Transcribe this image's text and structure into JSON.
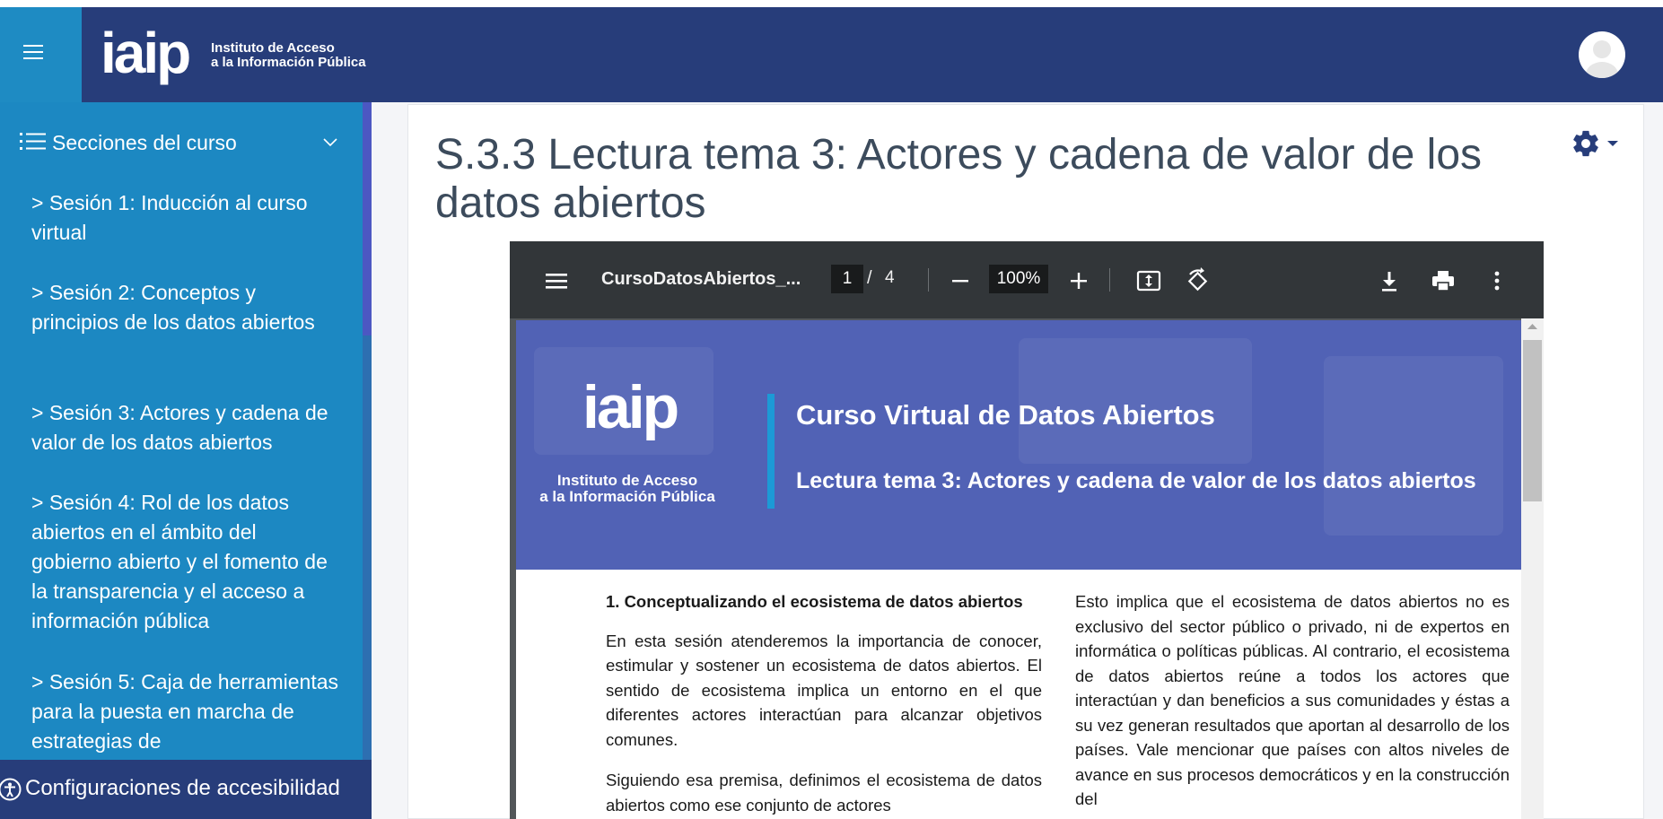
{
  "header": {
    "logo_word": "iaip",
    "logo_line1": "Instituto de Acceso",
    "logo_line2": "a la Información Pública"
  },
  "sidebar": {
    "sections_label": "Secciones del curso",
    "items": [
      {
        "label": "> Sesión 1: Inducción al curso virtual"
      },
      {
        "label": "> Sesión 2: Conceptos y principios de los datos abiertos"
      },
      {
        "label": "> Sesión 3: Actores y cadena de valor de los datos abiertos"
      },
      {
        "label": "> Sesión 4: Rol de los datos abiertos en el ámbito del gobierno abierto y el fomento de la transparencia y el acceso a información pública"
      },
      {
        "label": "> Sesión 5: Caja de herramientas para la puesta en marcha de estrategias de"
      }
    ],
    "accessibility_label": "Configuraciones de accesibilidad"
  },
  "main": {
    "title": "S.3.3 Lectura tema 3: Actores y cadena de valor de los datos abiertos"
  },
  "pdf": {
    "filename": "CursoDatosAbiertos_...",
    "current_page": "1",
    "separator": "/",
    "total_pages": "4",
    "zoom": "100%",
    "banner": {
      "logo_word": "iaip",
      "logo_line1": "Instituto de Acceso",
      "logo_line2": "a la Información Pública",
      "title": "Curso Virtual de Datos Abiertos",
      "subtitle": "Lectura tema 3: Actores y cadena de valor de los datos abiertos"
    },
    "content": {
      "heading": "1.  Conceptualizando el ecosistema de datos abiertos",
      "left_p1": "En esta sesión atenderemos la importancia de conocer, estimular y sostener un ecosistema de datos abiertos.  El sentido de ecosistema implica un entorno en el que diferentes actores interactúan para alcanzar objetivos comunes.",
      "left_p2": "Siguiendo esa premisa, definimos el ecosistema de datos abiertos como ese conjunto de actores",
      "right_p1": "Esto implica que el ecosistema de datos abiertos no es exclusivo del sector público o privado, ni de expertos en informática o políticas públicas.  Al contrario, el ecosistema de datos abiertos reúne a todos los actores que interactúan y dan beneficios a sus comunidades y éstas a su vez generan resultados que aportan al desarrollo de los países.  Vale mencionar que países con altos niveles de avance en sus procesos democráticos y en la construcción del"
    }
  },
  "colors": {
    "navbar": "#273d7a",
    "sidebar": "#1c88c2",
    "banner": "#5162b5",
    "pdf_toolbar": "#323639",
    "gear": "#273d7a"
  },
  "icons": [
    "menu-icon",
    "list-icon",
    "chevron-down-icon",
    "user-avatar-icon",
    "gear-icon",
    "caret-down-icon",
    "pdf-menu-icon",
    "zoom-out-icon",
    "zoom-in-icon",
    "fit-page-icon",
    "rotate-icon",
    "download-icon",
    "print-icon",
    "more-vert-icon",
    "accessibility-icon"
  ]
}
